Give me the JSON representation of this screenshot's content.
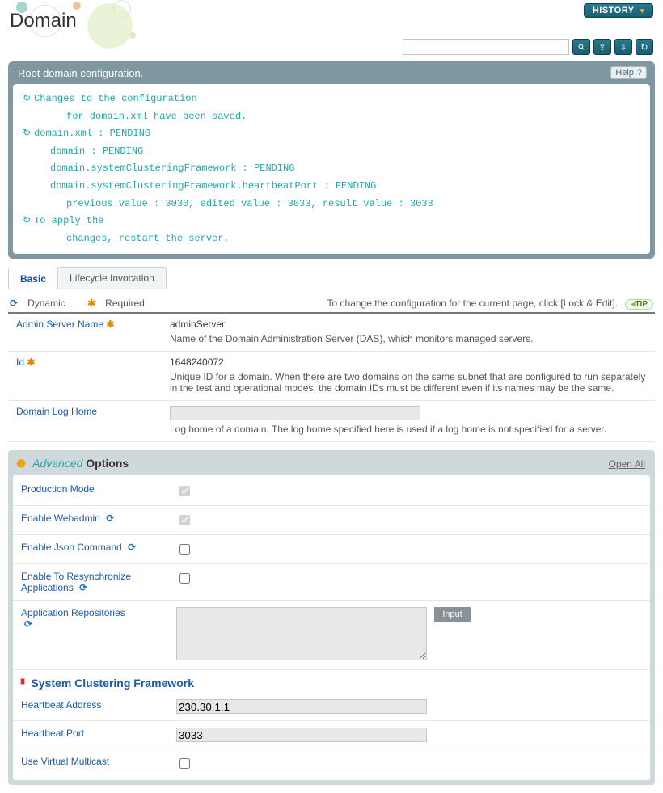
{
  "header": {
    "title": "Domain",
    "history_label": "HISTORY"
  },
  "search": {
    "placeholder": ""
  },
  "panel": {
    "title": "Root domain configuration.",
    "help_label": "Help",
    "log_lines": [
      "Changes to the configuration",
      "for domain.xml have been saved.",
      "domain.xml : PENDING",
      "domain : PENDING",
      "domain.systemClusteringFramework : PENDING",
      "domain.systemClusteringFramework.heartbeatPort : PENDING",
      "previous value : 3030, edited value : 3033, result value : 3033",
      "To apply the",
      "changes, restart the server."
    ]
  },
  "tabs": {
    "basic": "Basic",
    "lifecycle": "Lifecycle Invocation"
  },
  "legend": {
    "dynamic": "Dynamic",
    "required": "Required",
    "tip_text": "To change the configuration for the current page, click [Lock & Edit].",
    "tip_label": "TIP"
  },
  "basic_form": {
    "admin_server_name_label": "Admin Server Name",
    "admin_server_name_value": "adminServer",
    "admin_server_name_desc": "Name of the Domain Administration Server (DAS), which monitors managed servers.",
    "id_label": "Id",
    "id_value": "1648240072",
    "id_desc": "Unique ID for a domain. When there are two domains on the same subnet that are configured to run separately in the test and operational modes, the domain IDs must be different even if its names may be the same.",
    "domain_log_home_label": "Domain Log Home",
    "domain_log_home_value": "",
    "domain_log_home_desc": "Log home of a domain. The log home specified here is used if a log home is not specified for a server."
  },
  "advanced": {
    "title_prefix": "Advanced",
    "title_suffix": " Options",
    "open_all": "Open All",
    "production_mode_label": "Production Mode",
    "enable_webadmin_label": "Enable Webadmin",
    "enable_json_label": "Enable Json Command",
    "enable_resync_label": "Enable To Resynchronize Applications",
    "app_repos_label": "Application Repositories",
    "input_btn": "Input",
    "scf_title": "System Clustering Framework",
    "heartbeat_addr_label": "Heartbeat Address",
    "heartbeat_addr_value": "230.30.1.1",
    "heartbeat_port_label": "Heartbeat Port",
    "heartbeat_port_value": "3033",
    "use_vmulticast_label": "Use Virtual Multicast"
  }
}
